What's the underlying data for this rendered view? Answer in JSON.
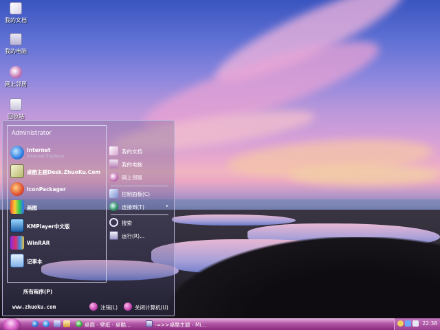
{
  "desktop": {
    "icons": [
      {
        "label": "我的文档",
        "icon": "documents-icon"
      },
      {
        "label": "我的电脑",
        "icon": "computer-icon"
      },
      {
        "label": "网上邻居",
        "icon": "network-icon"
      },
      {
        "label": "回收站",
        "icon": "recycle-bin-icon"
      }
    ]
  },
  "start_menu": {
    "user": "Administrator",
    "programs": [
      {
        "title": "Internet",
        "subtitle": "Internet Explorer",
        "icon": "internet-explorer-icon"
      },
      {
        "title": "桌酷主题Desk.ZhuoKu.Com",
        "icon": "zhuoku-icon"
      },
      {
        "title": "IconPackager",
        "icon": "iconpackager-icon"
      },
      {
        "title": "画图",
        "icon": "paint-icon"
      },
      {
        "title": "KMPlayer中文版",
        "icon": "kmplayer-icon"
      },
      {
        "title": "WinRAR",
        "icon": "winrar-icon"
      },
      {
        "title": "记事本",
        "icon": "notepad-icon"
      }
    ],
    "all_programs": "所有程序(P)",
    "places": [
      {
        "label": "我的文档",
        "icon": "documents-icon"
      },
      {
        "label": "我的电脑",
        "icon": "computer-icon"
      },
      {
        "label": "网上邻居",
        "icon": "network-icon"
      }
    ],
    "settings": [
      {
        "label": "控制面板(C)",
        "icon": "control-panel-icon"
      },
      {
        "label": "连接到(T)",
        "icon": "connect-icon",
        "submenu": "▸"
      }
    ],
    "tools": [
      {
        "label": "搜索",
        "icon": "search-icon"
      },
      {
        "label": "运行(R)...",
        "icon": "run-icon"
      }
    ],
    "footer": {
      "url": "www.zhuoku.com",
      "logoff": "注销(L)",
      "shutdown": "关闭计算机(U)"
    }
  },
  "taskbar": {
    "tasks": [
      {
        "label": "桌面 - 壁纸 - 桌酷...",
        "icon": "browser-icon"
      },
      {
        "label": "-=>>桌酷主题 - Mi...",
        "icon": "window-icon"
      }
    ],
    "clock": "22:38"
  },
  "colors": {
    "taskbar_top": "#e4a6dc",
    "taskbar_bottom": "#8a2a80",
    "start_orb": "#d25ac2",
    "menu_border": "#b8b0d8"
  }
}
